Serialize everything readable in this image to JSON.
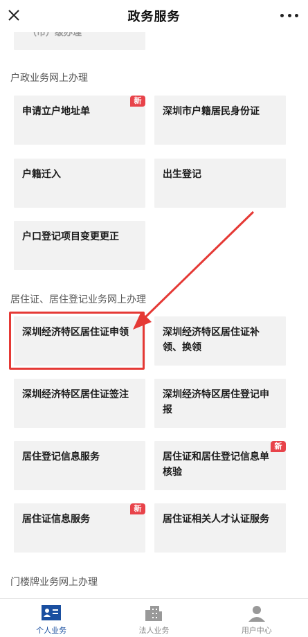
{
  "header": {
    "title": "政务服务",
    "close_icon": "close-icon",
    "more_icon": "more-icon"
  },
  "cut_top_card": {
    "label": "（市）级办理"
  },
  "sections": [
    {
      "title": "户政业务网上办理",
      "cards": [
        {
          "label": "申请立户地址单",
          "badge": "新"
        },
        {
          "label": "深圳市户籍居民身份证"
        },
        {
          "label": "户籍迁入"
        },
        {
          "label": "出生登记"
        },
        {
          "label": "户口登记项目变更更正"
        }
      ]
    },
    {
      "title": "居住证、居住登记业务网上办理",
      "cards": [
        {
          "label": "深圳经济特区居住证申领"
        },
        {
          "label": "深圳经济特区居住证补领、换领"
        },
        {
          "label": "深圳经济特区居住证签注"
        },
        {
          "label": "深圳经济特区居住登记申报"
        },
        {
          "label": "居住登记信息服务"
        },
        {
          "label": "居住证和居住登记信息单核验",
          "badge": "新"
        },
        {
          "label": "居住证信息服务",
          "badge": "新"
        },
        {
          "label": "居住证相关人才认证服务"
        }
      ]
    },
    {
      "title": "门楼牌业务网上办理",
      "cards": []
    }
  ],
  "tabs": [
    {
      "label": "个人业务",
      "icon": "person-card-icon",
      "active": true
    },
    {
      "label": "法人业务",
      "icon": "building-icon",
      "active": false
    },
    {
      "label": "用户中心",
      "icon": "user-icon",
      "active": false
    }
  ],
  "colors": {
    "accent": "#1a4fa0",
    "badge": "#e8434a",
    "highlight": "#e53935",
    "card_bg": "#f2f2f2"
  }
}
